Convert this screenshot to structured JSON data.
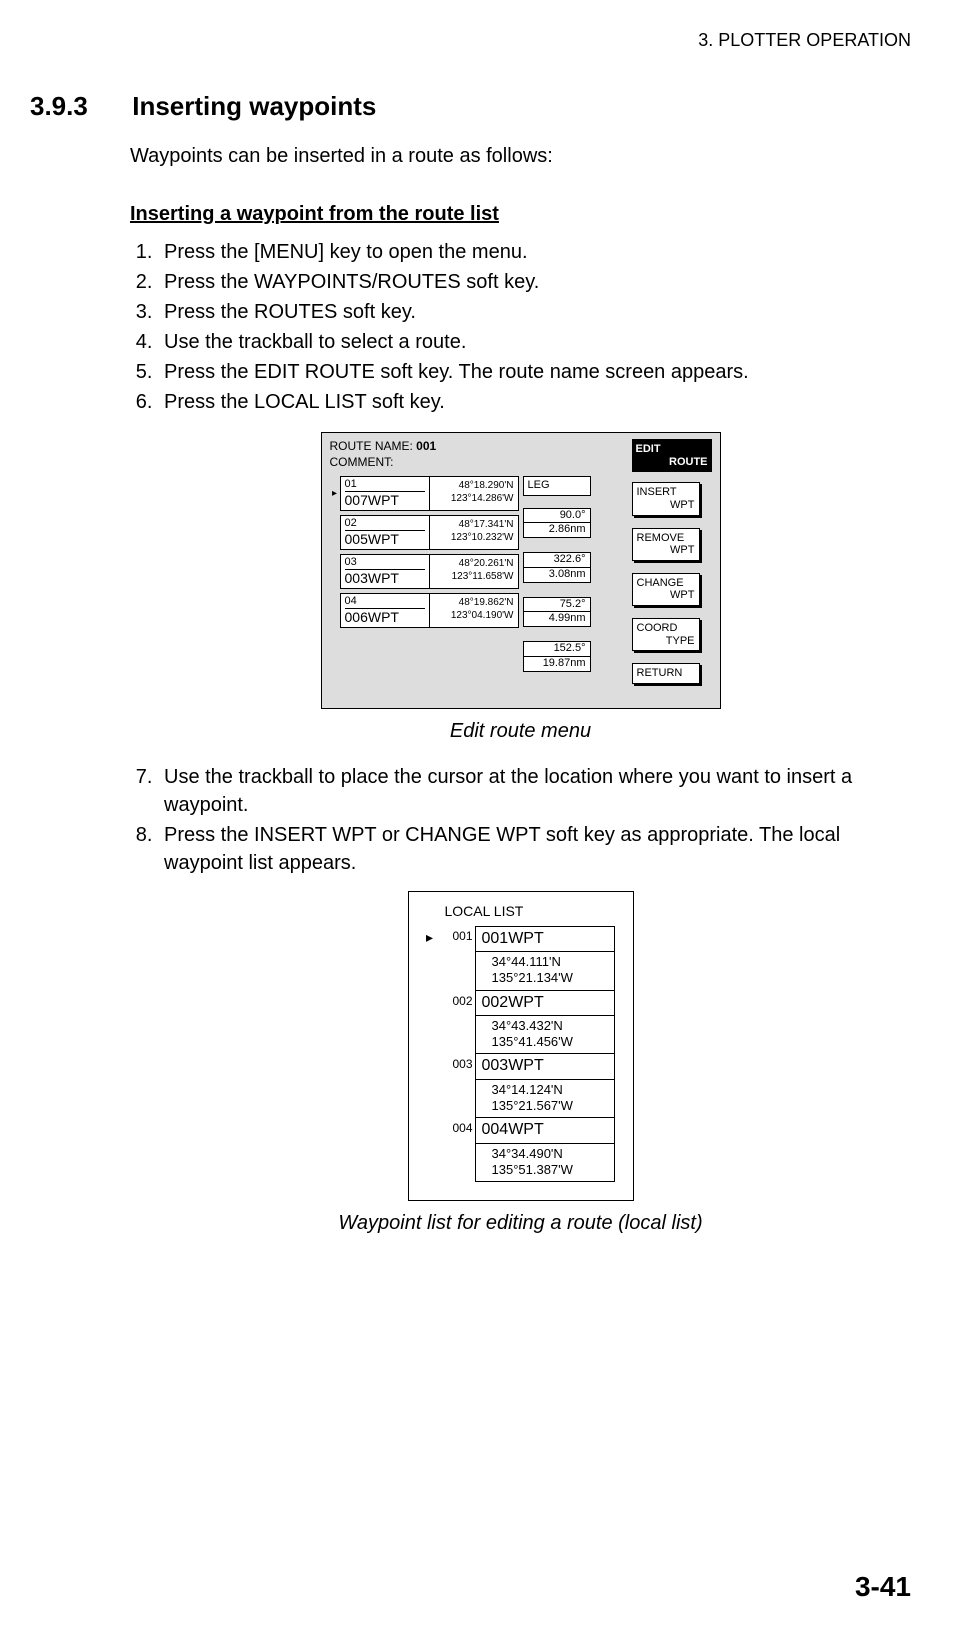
{
  "header": {
    "running": "3. PLOTTER OPERATION"
  },
  "section": {
    "number": "3.9.3",
    "title": "Inserting waypoints"
  },
  "intro": "Waypoints can be inserted in a route as follows:",
  "subheading1": "Inserting a waypoint from the route list",
  "steps1": [
    "Press the [MENU] key to open the menu.",
    "Press the WAYPOINTS/ROUTES soft key.",
    "Press the ROUTES soft key.",
    "Use the trackball to select a route.",
    "Press the EDIT ROUTE soft key. The route name screen appears.",
    "Press the LOCAL LIST soft key."
  ],
  "editRoute": {
    "routeNameLabel": "ROUTE NAME: ",
    "routeNameValue": "001",
    "commentLabel": "COMMENT:",
    "legLabel": "LEG",
    "softTitleLine1": "EDIT",
    "softTitleLine2": "ROUTE",
    "softkeys": [
      {
        "l1": "INSERT",
        "l2": "WPT"
      },
      {
        "l1": "REMOVE",
        "l2": "WPT"
      },
      {
        "l1": "CHANGE",
        "l2": "WPT"
      },
      {
        "l1": "COORD",
        "l2": "TYPE"
      },
      {
        "l1": "RETURN",
        "l2": ""
      }
    ],
    "rows": [
      {
        "num": "01",
        "name": "007WPT",
        "lat": "48°18.290'N",
        "lon": "123°14.286'W"
      },
      {
        "num": "02",
        "name": "005WPT",
        "lat": "48°17.341'N",
        "lon": "123°10.232'W"
      },
      {
        "num": "03",
        "name": "003WPT",
        "lat": "48°20.261'N",
        "lon": "123°11.658'W"
      },
      {
        "num": "04",
        "name": "006WPT",
        "lat": "48°19.862'N",
        "lon": "123°04.190'W"
      }
    ],
    "legs": [
      {
        "brg": "90.0°",
        "dist": "2.86nm"
      },
      {
        "brg": "322.6°",
        "dist": "3.08nm"
      },
      {
        "brg": "75.2°",
        "dist": "4.99nm"
      },
      {
        "brg": "152.5°",
        "dist": "19.87nm"
      }
    ]
  },
  "caption1": "Edit route menu",
  "steps2": [
    "Use the trackball to place the cursor at the location where you want to insert a waypoint.",
    "Press the INSERT WPT or CHANGE WPT soft key as appropriate. The local waypoint list appears."
  ],
  "localList": {
    "title": "LOCAL LIST",
    "items": [
      {
        "num": "001",
        "name": "001WPT",
        "lat": "34°44.111'N",
        "lon": "135°21.134'W"
      },
      {
        "num": "002",
        "name": "002WPT",
        "lat": "34°43.432'N",
        "lon": "135°41.456'W"
      },
      {
        "num": "003",
        "name": "003WPT",
        "lat": "34°14.124'N",
        "lon": "135°21.567'W"
      },
      {
        "num": "004",
        "name": "004WPT",
        "lat": "34°34.490'N",
        "lon": "135°51.387'W"
      }
    ]
  },
  "caption2": "Waypoint list for editing a route (local list)",
  "pageNumber": "3-41"
}
